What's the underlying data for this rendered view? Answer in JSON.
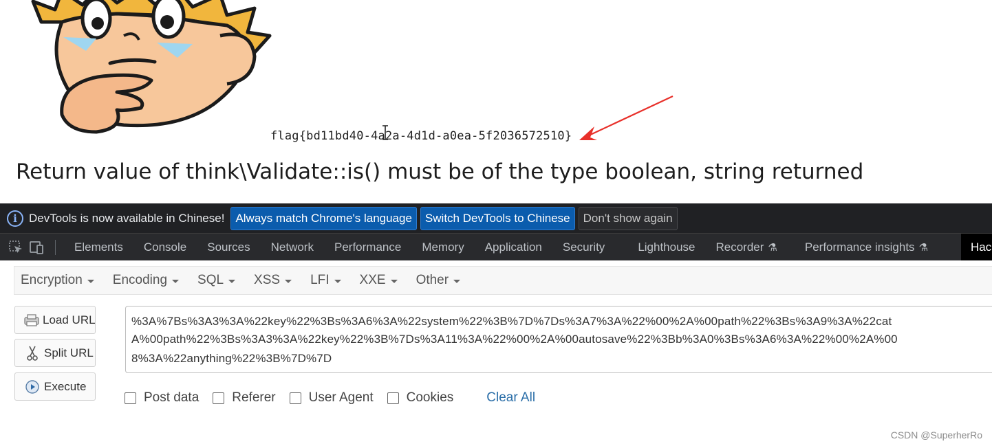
{
  "page": {
    "flag_text": "flag{bd11bd40-4a2a-4d1d-a0ea-5f2036572510}",
    "error_message": "Return value of think\\Validate::is() must be of the type boolean, string returned"
  },
  "infobar": {
    "message": "DevTools is now available in Chinese!",
    "always_match_label": "Always match Chrome's language",
    "switch_label": "Switch DevTools to Chinese",
    "dont_show_label": "Don't show again"
  },
  "devtools_tabs": [
    "Elements",
    "Console",
    "Sources",
    "Network",
    "Performance",
    "Memory",
    "Application",
    "Security",
    "Lighthouse",
    "Recorder",
    "Performance insights",
    "Hac"
  ],
  "hackbar": {
    "menu": [
      "Encryption",
      "Encoding",
      "SQL",
      "XSS",
      "LFI",
      "XXE",
      "Other"
    ],
    "buttons": {
      "load_url": "Load URL",
      "split_url": "Split URL",
      "execute": "Execute"
    },
    "url_lines": [
      "%3A%7Bs%3A3%3A%22key%22%3Bs%3A6%3A%22system%22%3B%7D%7Ds%3A7%3A%22%00%2A%00path%22%3Bs%3A9%3A%22cat",
      "A%00path%22%3Bs%3A3%3A%22key%22%3B%7Ds%3A11%3A%22%00%2A%00autosave%22%3Bb%3A0%3Bs%3A6%3A%22%00%2A%00",
      "8%3A%22anything%22%3B%7D%7D"
    ],
    "options": [
      "Post data",
      "Referer",
      "User Agent",
      "Cookies"
    ],
    "clear_all": "Clear All"
  },
  "watermark": "CSDN @SuperherRo",
  "colors": {
    "devtools_bg": "#202124",
    "primary_button": "#0b5cad",
    "arrow": "#e8302a",
    "link": "#2a6ea8"
  }
}
